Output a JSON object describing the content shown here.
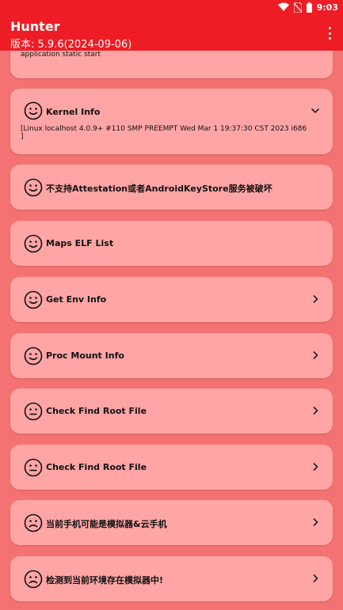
{
  "status_bar": {
    "time": "9:03"
  },
  "header": {
    "title": "Hunter",
    "version": "版本: 5.9.6(2024-09-06)"
  },
  "cards": [
    {
      "body": "application static start"
    },
    {
      "title": "Kernel Info",
      "body": "[Linux localhost 4.0.9+ #110 SMP PREEMPT Wed Mar 1 19:37:30 CST 2023 i686\n]"
    },
    {
      "title": "不支持Attestation或者AndroidKeyStore服务被破坏"
    },
    {
      "title": "Maps ELF List"
    },
    {
      "title": "Get Env Info"
    },
    {
      "title": "Proc Mount Info"
    },
    {
      "title": "Check Find Root File"
    },
    {
      "title": "Check Find Root File"
    },
    {
      "title": "当前手机可能是模拟器&云手机"
    },
    {
      "title": "检测到当前环境存在模拟器中!"
    }
  ],
  "colors": {
    "app_bar": "#ee1c24",
    "background": "#f57272",
    "card": "#ffa5a5"
  },
  "icons": [
    "wifi-icon",
    "sim-off-icon",
    "battery-icon",
    "overflow-menu-icon",
    "smiley-face-icon",
    "neutral-face-icon",
    "sad-face-icon",
    "chevron-down-icon",
    "chevron-right-icon"
  ]
}
